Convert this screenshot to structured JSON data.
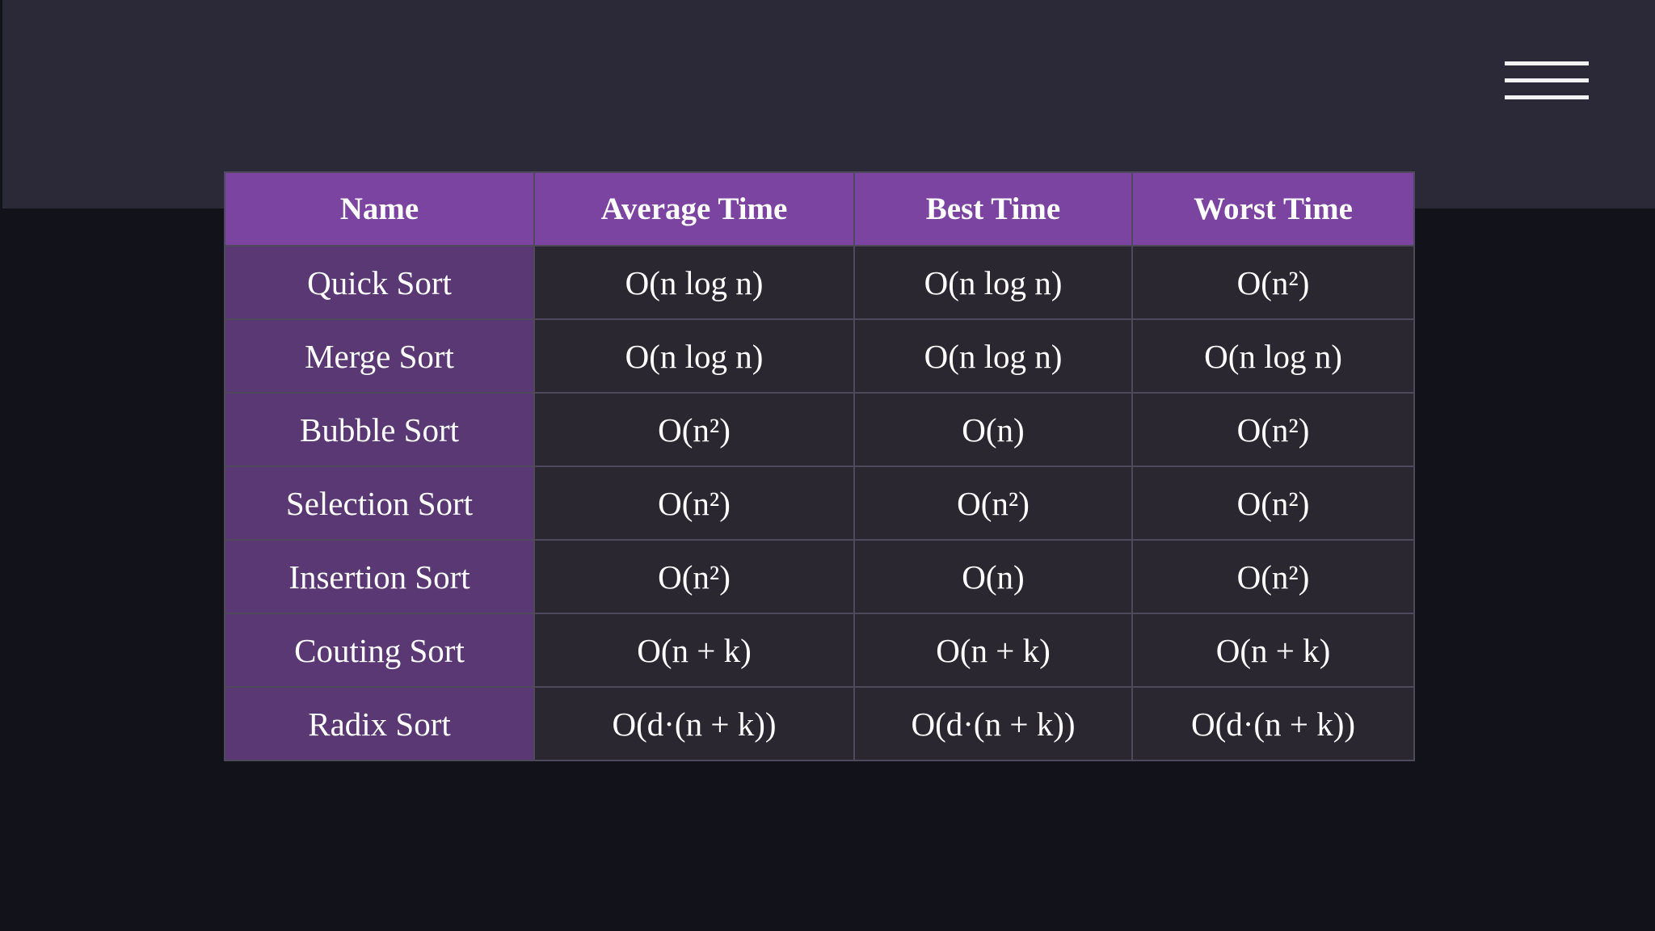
{
  "menu": {
    "icon": "hamburger-menu-icon"
  },
  "table": {
    "headers": [
      "Name",
      "Average Time",
      "Best Time",
      "Worst Time"
    ],
    "rows": [
      [
        "Quick Sort",
        "O(n log n)",
        "O(n log n)",
        "O(n²)"
      ],
      [
        "Merge Sort",
        "O(n log n)",
        "O(n log n)",
        "O(n log n)"
      ],
      [
        "Bubble Sort",
        "O(n²)",
        "O(n)",
        "O(n²)"
      ],
      [
        "Selection Sort",
        "O(n²)",
        "O(n²)",
        "O(n²)"
      ],
      [
        "Insertion Sort",
        "O(n²)",
        "O(n)",
        "O(n²)"
      ],
      [
        "Couting Sort",
        "O(n + k)",
        "O(n + k)",
        "O(n + k)"
      ],
      [
        "Radix Sort",
        "O(d·(n + k))",
        "O(d·(n + k))",
        "O(d·(n + k))"
      ]
    ]
  },
  "colors": {
    "page_background": "#12121b",
    "top_band": "#2b2937",
    "header_background": "#7a44a0",
    "name_column_background": "#5a3873",
    "cell_background": "#2a2731",
    "text": "#ffffff"
  }
}
